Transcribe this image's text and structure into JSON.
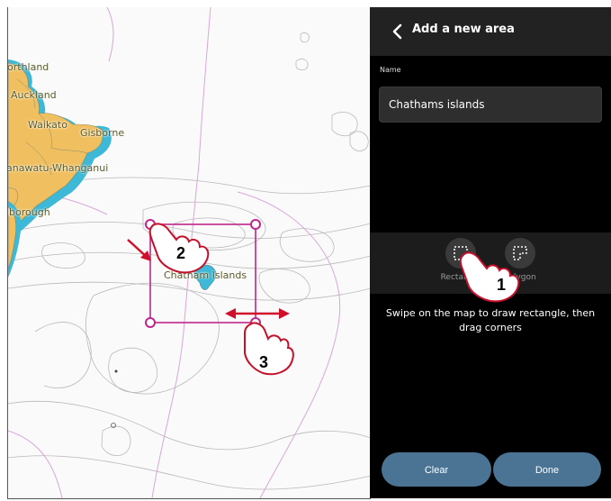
{
  "map": {
    "places": {
      "northland": "orthland",
      "auckland": "Auckland",
      "waikato": "Waikato",
      "gisborne": "Gisborne",
      "manawatu": "anawatu-Whanganui",
      "marlborough": "lborough",
      "chatham": "Chatham Islands"
    }
  },
  "panel": {
    "title": "Add a new area",
    "name_label": "Name",
    "name_value": "Chathams islands",
    "tools": {
      "rectangle": "Rectangle",
      "polygon": "Polygon"
    },
    "instructions": "Swipe on the map to draw rectangle, then drag corners",
    "clear_label": "Clear",
    "done_label": "Done"
  },
  "callouts": {
    "one": "1",
    "two": "2",
    "three": "3"
  },
  "colors": {
    "panel_bg": "#000000",
    "header_bg": "#222222",
    "button_blue": "#4a7394",
    "selection_magenta": "#c0268a",
    "callout_red": "#c4102a",
    "land_ochre": "#f0c060",
    "water_cyan": "#3db8d6"
  }
}
